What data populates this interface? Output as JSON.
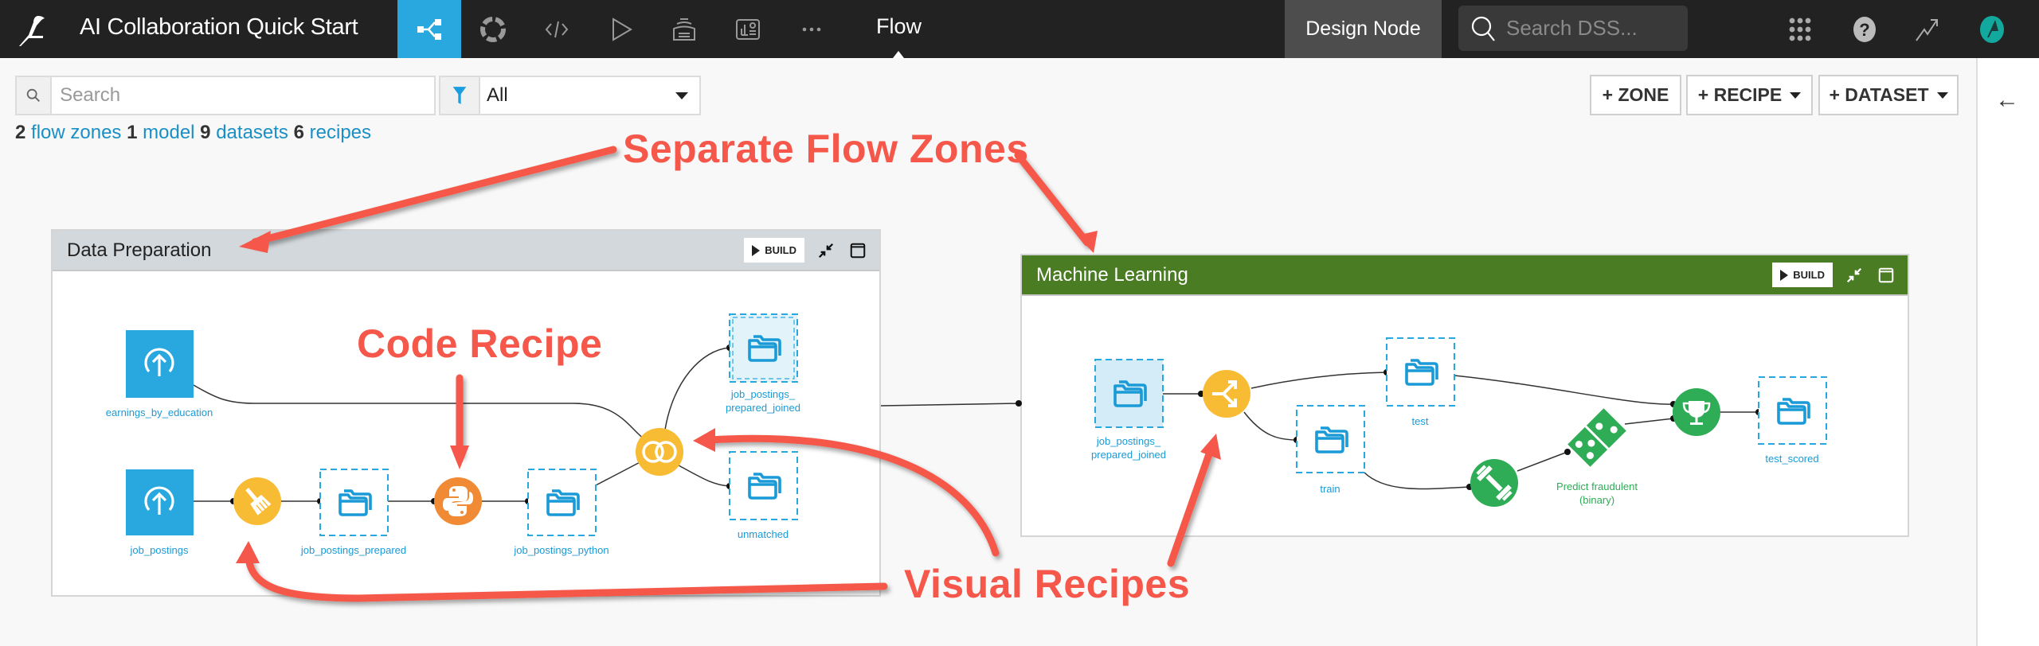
{
  "header": {
    "project_title": "AI Collaboration Quick Start",
    "nav_tabs": [
      {
        "name": "flow",
        "icon": "flow-icon",
        "active": true
      },
      {
        "name": "ml",
        "icon": "ml-icon",
        "active": false
      },
      {
        "name": "code",
        "icon": "code-icon",
        "active": false
      },
      {
        "name": "jobs",
        "icon": "run-icon",
        "active": false
      },
      {
        "name": "datasets",
        "icon": "stack-icon",
        "active": false
      },
      {
        "name": "dashboards",
        "icon": "dashboard-icon",
        "active": false
      },
      {
        "name": "more",
        "icon": "more-icon",
        "active": false
      }
    ],
    "current_section": "Flow",
    "node_label": "Design Node",
    "search_placeholder": "Search DSS..."
  },
  "toolbar": {
    "search_placeholder": "Search",
    "filter_value": "All",
    "add_zone_label": "+ ZONE",
    "add_recipe_label": "+ RECIPE",
    "add_dataset_label": "+ DATASET"
  },
  "stats": {
    "zones_count": "2",
    "zones_label": "flow zones",
    "models_count": "1",
    "models_label": "model",
    "datasets_count": "9",
    "datasets_label": "datasets",
    "recipes_count": "6",
    "recipes_label": "recipes"
  },
  "zones": {
    "data_prep": {
      "title": "Data Preparation",
      "header_color": "#d3d8dc",
      "build_label": "BUILD",
      "nodes": {
        "earnings_by_education": "earnings_by_education",
        "job_postings": "job_postings",
        "job_postings_prepared": "job_postings_prepared",
        "job_postings_python": "job_postings_python",
        "joined_line1": "job_postings_",
        "joined_line2": "prepared_joined",
        "unmatched": "unmatched"
      }
    },
    "ml": {
      "title": "Machine Learning",
      "header_color": "#4a7c23",
      "build_label": "BUILD",
      "nodes": {
        "joined_line1": "job_postings_",
        "joined_line2": "prepared_joined",
        "test": "test",
        "train": "train",
        "model_line1": "Predict fraudulent",
        "model_line2": "(binary)",
        "test_scored": "test_scored"
      }
    }
  },
  "annotations": {
    "zones": "Separate Flow Zones",
    "code_recipe": "Code Recipe",
    "visual_recipes": "Visual Recipes",
    "color": "#f5584a"
  },
  "colors": {
    "accent": "#29a8e0",
    "dataset": "#1a9ad6",
    "visual_recipe": "#f8bb34",
    "code_recipe": "#f08a35",
    "ml": "#2eac56"
  }
}
